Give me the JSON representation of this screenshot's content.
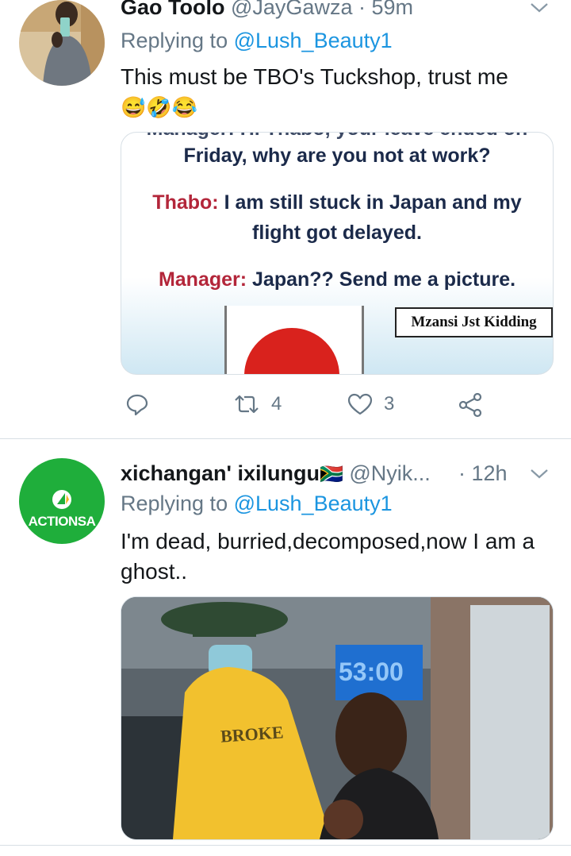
{
  "tweet1": {
    "name": "Gao Toolo",
    "handle": "@JayGawza",
    "separator": " · ",
    "time": "59m",
    "replying_prefix": "Replying to ",
    "replying_to": "@Lush_Beauty1",
    "text": "This must be TBO's Tuckshop, trust me",
    "emojis": "😅🤣😂",
    "media": {
      "line0": "Manager: Hi Thabo, your leave ended on",
      "line1": "Friday, why are you not at work?",
      "line2_speaker": "Thabo:",
      "line2_text": " I am still stuck in Japan and my",
      "line3": "flight got delayed.",
      "line4_speaker": "Manager:",
      "line4_text": " Japan?? Send me a picture.",
      "watermark": "Mzansi Jst Kidding"
    },
    "actions": {
      "retweets": "4",
      "likes": "3"
    }
  },
  "tweet2": {
    "name": "xichangan' ixilungu",
    "flag": "🇿🇦",
    "handle": "@Nyik...",
    "separator": " · ",
    "time": "12h",
    "avatar_text": "ACTIONSA",
    "replying_prefix": "Replying to ",
    "replying_to": "@Lush_Beauty1",
    "text": "I'm dead, burried,decomposed,now I am a ghost..",
    "media": {
      "screen_text": "53:00",
      "shirt_text": "BROKE"
    }
  },
  "colors": {
    "link": "#1b95e0",
    "secondary": "#657786",
    "actionsa_green": "#1fae3b"
  }
}
